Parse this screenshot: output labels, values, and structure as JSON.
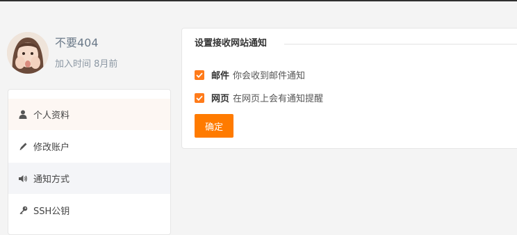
{
  "profile": {
    "username": "不要404",
    "joined": "加入时间 8月前"
  },
  "sidebar": {
    "items": [
      {
        "label": "个人资料",
        "icon": "user-icon"
      },
      {
        "label": "修改账户",
        "icon": "pencil-icon"
      },
      {
        "label": "通知方式",
        "icon": "speaker-icon"
      },
      {
        "label": "SSH公钥",
        "icon": "key-icon"
      }
    ]
  },
  "notify": {
    "title": "设置接收网站通知",
    "options": [
      {
        "name": "邮件",
        "desc": "你会收到邮件通知",
        "checked": true
      },
      {
        "name": "网页",
        "desc": "在网页上会有通知提醒",
        "checked": true
      }
    ],
    "confirm_label": "确定"
  },
  "colors": {
    "accent": "#ff7b00",
    "checkbox": "#ff7b1a",
    "username": "#6b7a89"
  }
}
